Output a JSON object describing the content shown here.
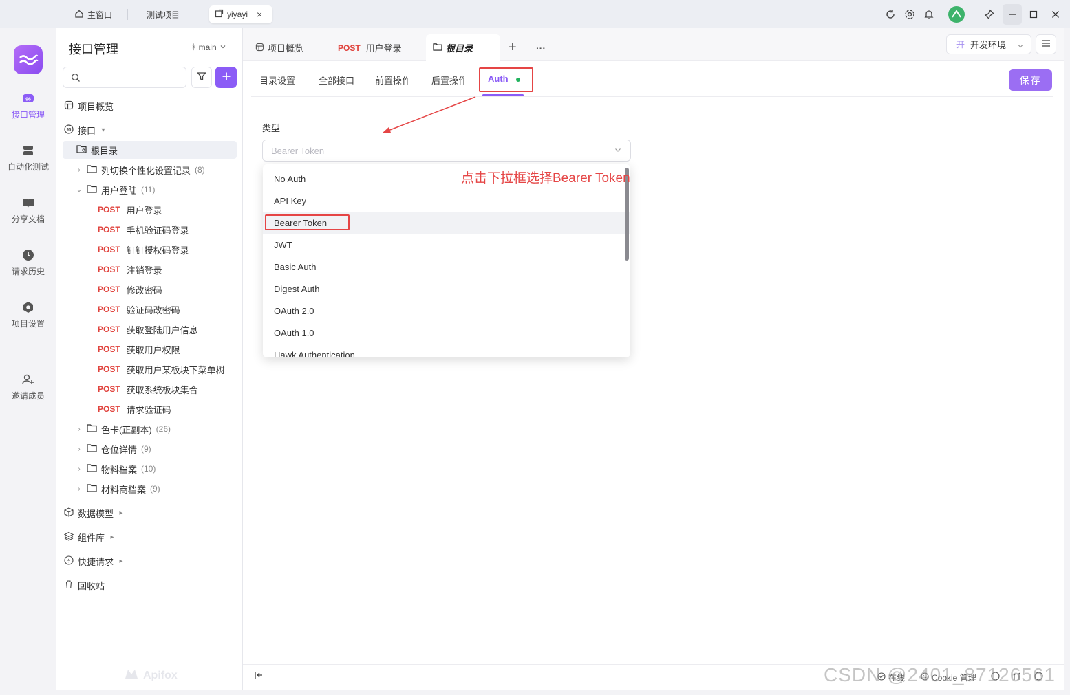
{
  "titlebar": {
    "tabs": [
      {
        "label": "主窗口",
        "icon": "home-icon"
      },
      {
        "label": "测试项目"
      },
      {
        "label": "yiyayi",
        "icon": "external-link-icon",
        "close": "×"
      }
    ]
  },
  "rail": {
    "items": [
      {
        "label": "接口管理",
        "icon": "api-icon",
        "active": true
      },
      {
        "label": "自动化测试",
        "icon": "automation-icon"
      },
      {
        "label": "分享文档",
        "icon": "book-icon"
      },
      {
        "label": "请求历史",
        "icon": "clock-icon"
      },
      {
        "label": "项目设置",
        "icon": "settings-icon"
      },
      {
        "label": "邀请成员",
        "icon": "add-user-icon"
      }
    ]
  },
  "sidebar": {
    "title": "接口管理",
    "branch": "main",
    "overview": "项目概览",
    "api_section": "接口",
    "root": "根目录",
    "folders": [
      {
        "label": "列切换个性化设置记录",
        "count": "(8)"
      },
      {
        "label": "用户登陆",
        "count": "(11)"
      }
    ],
    "method": "POST",
    "endpoints": [
      "用户登录",
      "手机验证码登录",
      "钉钉授权码登录",
      "注销登录",
      "修改密码",
      "验证码改密码",
      "获取登陆用户信息",
      "获取用户权限",
      "获取用户某板块下菜单树",
      "获取系统板块集合",
      "请求验证码"
    ],
    "more_folders": [
      {
        "label": "色卡(正副本)",
        "count": "(26)"
      },
      {
        "label": "仓位详情",
        "count": "(9)"
      },
      {
        "label": "物料档案",
        "count": "(10)"
      },
      {
        "label": "材料商档案",
        "count": "(9)"
      }
    ],
    "sections": [
      "数据模型",
      "组件库",
      "快捷请求",
      "回收站"
    ],
    "brand": "Apifox"
  },
  "main": {
    "tabs": [
      {
        "label": "项目概览"
      },
      {
        "method": "POST",
        "label": "用户登录"
      },
      {
        "label": "根目录"
      }
    ],
    "add_tab": "+",
    "more_tabs": "···",
    "env": {
      "badge": "开",
      "label": "开发环境"
    },
    "subtabs": [
      "目录设置",
      "全部接口",
      "前置操作",
      "后置操作",
      "Auth"
    ],
    "save": "保存",
    "type_label": "类型",
    "select_placeholder": "Bearer Token",
    "options": [
      "No Auth",
      "API Key",
      "Bearer Token",
      "JWT",
      "Basic Auth",
      "Digest Auth",
      "OAuth 2.0",
      "OAuth 1.0",
      "Hawk Authentication"
    ],
    "annotation": "点击下拉框选择Bearer Token",
    "footer": {
      "online": "在线",
      "cookie": "Cookie 管理"
    }
  },
  "watermark": "CSDN @2401_87126561",
  "colors": {
    "accent": "#8b5cf6",
    "post": "#e0433d",
    "annotation": "#e54545"
  }
}
